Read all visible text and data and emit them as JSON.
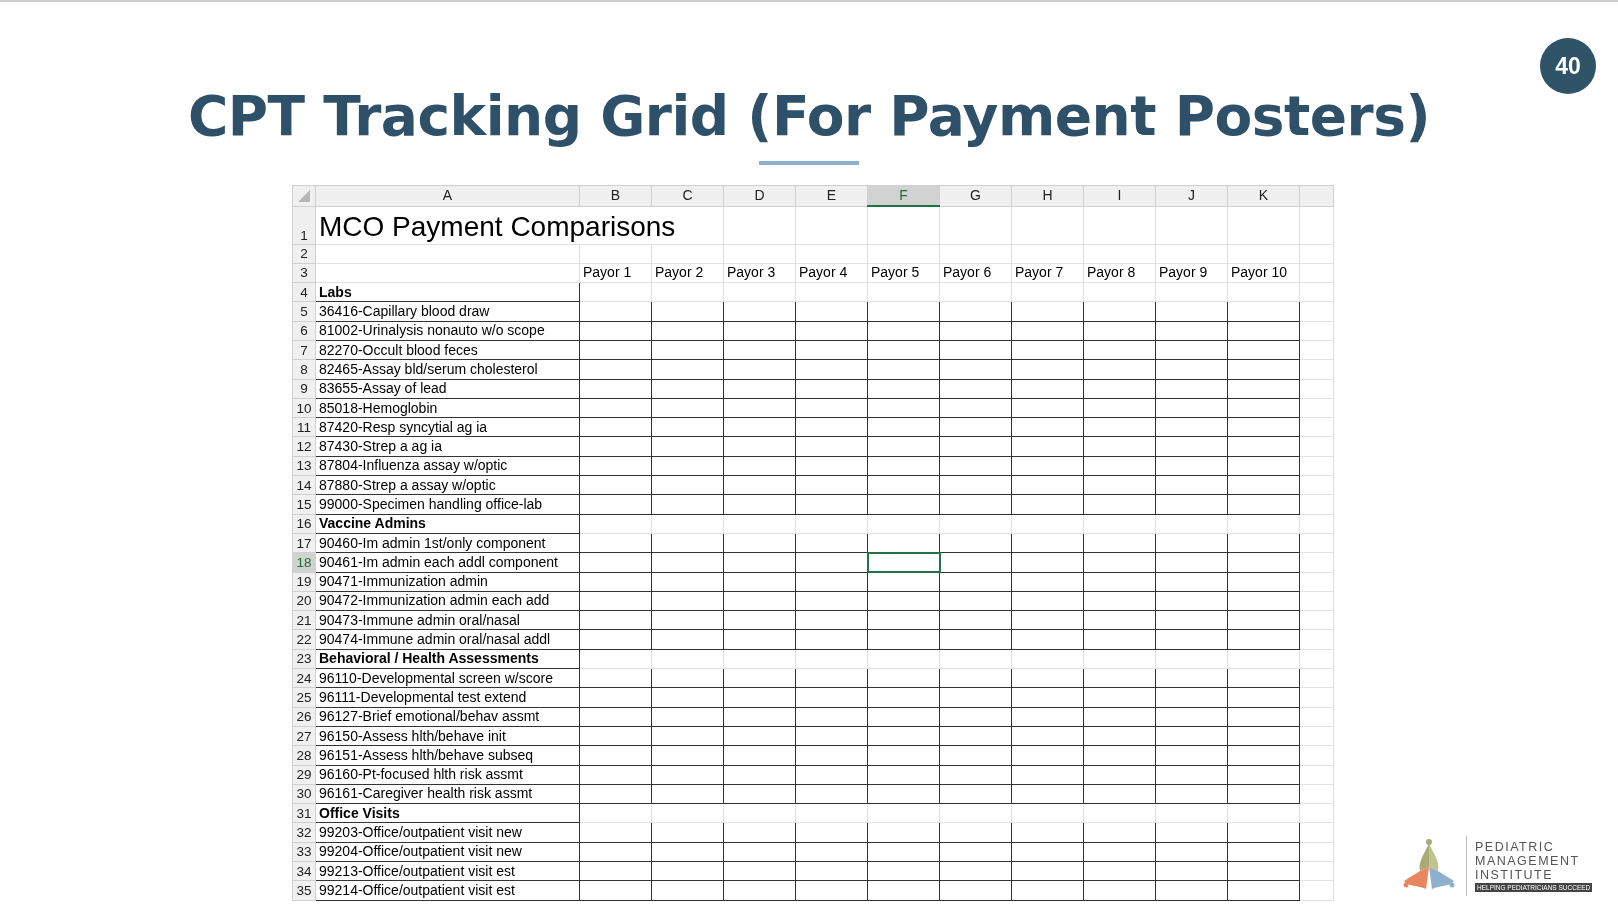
{
  "slide": {
    "title": "CPT Tracking Grid (For Payment Posters)",
    "page_number": "40"
  },
  "sheet": {
    "columns": [
      {
        "letter": "A",
        "selected": false
      },
      {
        "letter": "B",
        "selected": false
      },
      {
        "letter": "C",
        "selected": false
      },
      {
        "letter": "D",
        "selected": false
      },
      {
        "letter": "E",
        "selected": false
      },
      {
        "letter": "F",
        "selected": true
      },
      {
        "letter": "G",
        "selected": false
      },
      {
        "letter": "H",
        "selected": false
      },
      {
        "letter": "I",
        "selected": false
      },
      {
        "letter": "J",
        "selected": false
      },
      {
        "letter": "K",
        "selected": false
      }
    ],
    "rows": [
      {
        "number": "1",
        "selected": false,
        "kind": "title",
        "label": "MCO Payment Comparisons"
      },
      {
        "number": "2",
        "selected": false,
        "kind": "blank"
      },
      {
        "number": "3",
        "selected": false,
        "kind": "header",
        "cells": [
          "Payor 1",
          "Payor 2",
          "Payor 3",
          "Payor 4",
          "Payor 5",
          "Payor 6",
          "Payor 7",
          "Payor 8",
          "Payor 9",
          "Payor 10"
        ]
      },
      {
        "number": "4",
        "selected": false,
        "kind": "section",
        "label": "Labs"
      },
      {
        "number": "5",
        "selected": false,
        "kind": "item",
        "label": "36416-Capillary blood draw"
      },
      {
        "number": "6",
        "selected": false,
        "kind": "item",
        "label": "81002-Urinalysis nonauto w/o scope"
      },
      {
        "number": "7",
        "selected": false,
        "kind": "item",
        "label": "82270-Occult blood feces"
      },
      {
        "number": "8",
        "selected": false,
        "kind": "item",
        "label": "82465-Assay bld/serum cholesterol"
      },
      {
        "number": "9",
        "selected": false,
        "kind": "item",
        "label": "83655-Assay of lead"
      },
      {
        "number": "10",
        "selected": false,
        "kind": "item",
        "label": "85018-Hemoglobin"
      },
      {
        "number": "11",
        "selected": false,
        "kind": "item",
        "label": "87420-Resp syncytial ag ia"
      },
      {
        "number": "12",
        "selected": false,
        "kind": "item",
        "label": "87430-Strep a ag ia"
      },
      {
        "number": "13",
        "selected": false,
        "kind": "item",
        "label": "87804-Influenza assay w/optic"
      },
      {
        "number": "14",
        "selected": false,
        "kind": "item",
        "label": "87880-Strep a assay w/optic"
      },
      {
        "number": "15",
        "selected": false,
        "kind": "item",
        "label": "99000-Specimen handling office-lab"
      },
      {
        "number": "16",
        "selected": false,
        "kind": "section",
        "label": "Vaccine Admins"
      },
      {
        "number": "17",
        "selected": false,
        "kind": "item",
        "label": "90460-Im admin 1st/only component"
      },
      {
        "number": "18",
        "selected": true,
        "kind": "item",
        "label": "90461-Im admin each addl component"
      },
      {
        "number": "19",
        "selected": false,
        "kind": "item",
        "label": "90471-Immunization admin"
      },
      {
        "number": "20",
        "selected": false,
        "kind": "item",
        "label": "90472-Immunization admin each add"
      },
      {
        "number": "21",
        "selected": false,
        "kind": "item",
        "label": "90473-Immune admin oral/nasal"
      },
      {
        "number": "22",
        "selected": false,
        "kind": "item",
        "label": "90474-Immune admin oral/nasal addl"
      },
      {
        "number": "23",
        "selected": false,
        "kind": "section",
        "label": "Behavioral / Health Assessments"
      },
      {
        "number": "24",
        "selected": false,
        "kind": "item",
        "label": "96110-Developmental screen w/score"
      },
      {
        "number": "25",
        "selected": false,
        "kind": "item",
        "label": "96111-Developmental test extend"
      },
      {
        "number": "26",
        "selected": false,
        "kind": "item",
        "label": "96127-Brief emotional/behav assmt"
      },
      {
        "number": "27",
        "selected": false,
        "kind": "item",
        "label": "96150-Assess hlth/behave init"
      },
      {
        "number": "28",
        "selected": false,
        "kind": "item",
        "label": "96151-Assess hlth/behave subseq"
      },
      {
        "number": "29",
        "selected": false,
        "kind": "item",
        "label": "96160-Pt-focused hlth risk assmt"
      },
      {
        "number": "30",
        "selected": false,
        "kind": "item",
        "label": "96161-Caregiver health risk assmt"
      },
      {
        "number": "31",
        "selected": false,
        "kind": "section",
        "label": "Office Visits"
      },
      {
        "number": "32",
        "selected": false,
        "kind": "item",
        "label": "99203-Office/outpatient visit new"
      },
      {
        "number": "33",
        "selected": false,
        "kind": "item",
        "label": "99204-Office/outpatient visit new"
      },
      {
        "number": "34",
        "selected": false,
        "kind": "item",
        "label": "99213-Office/outpatient visit est"
      },
      {
        "number": "35",
        "selected": false,
        "kind": "item",
        "label": "99214-Office/outpatient visit est"
      }
    ]
  },
  "logo": {
    "lines": [
      "PEDIATRIC",
      "MANAGEMENT",
      "INSTITUTE"
    ],
    "tagline": "HELPING PEDIATRICIANS SUCCEED"
  }
}
